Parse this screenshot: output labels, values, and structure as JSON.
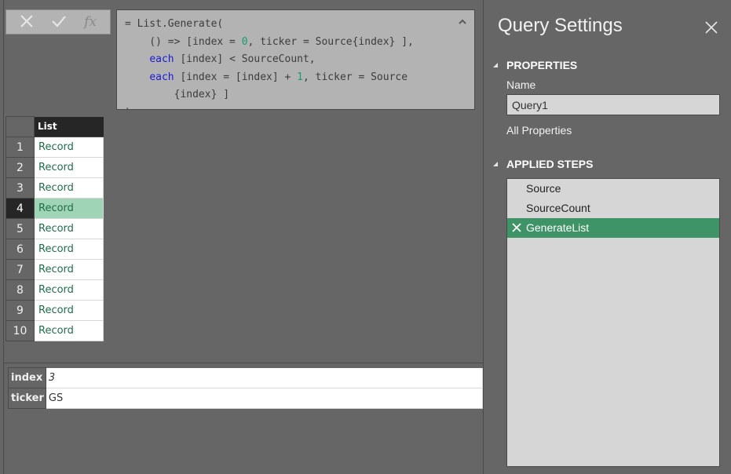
{
  "formula_bar": {
    "cancel_icon": "close-x-icon",
    "confirm_icon": "checkmark-icon",
    "fx_label": "fx",
    "lines": [
      {
        "parts": [
          {
            "t": "= List.Generate(",
            "c": ""
          }
        ]
      },
      {
        "parts": [
          {
            "t": "    () => [index = ",
            "c": ""
          },
          {
            "t": "0",
            "c": "num"
          },
          {
            "t": ", ticker = Source{index} ],",
            "c": ""
          }
        ]
      },
      {
        "parts": [
          {
            "t": "    ",
            "c": ""
          },
          {
            "t": "each",
            "c": "kw"
          },
          {
            "t": " [index] < SourceCount,",
            "c": ""
          }
        ]
      },
      {
        "parts": [
          {
            "t": "    ",
            "c": ""
          },
          {
            "t": "each",
            "c": "kw"
          },
          {
            "t": " [index = [index] + ",
            "c": ""
          },
          {
            "t": "1",
            "c": "num"
          },
          {
            "t": ", ticker = Source",
            "c": ""
          }
        ]
      },
      {
        "parts": [
          {
            "t": "        {index} ]",
            "c": ""
          }
        ]
      },
      {
        "parts": [
          {
            "t": ")",
            "c": ""
          }
        ]
      }
    ],
    "collapse_icon": "chevron-up-icon"
  },
  "grid": {
    "column_header": "List",
    "selected_row": 4,
    "rows": [
      {
        "num": "1",
        "value": "Record"
      },
      {
        "num": "2",
        "value": "Record"
      },
      {
        "num": "3",
        "value": "Record"
      },
      {
        "num": "4",
        "value": "Record"
      },
      {
        "num": "5",
        "value": "Record"
      },
      {
        "num": "6",
        "value": "Record"
      },
      {
        "num": "7",
        "value": "Record"
      },
      {
        "num": "8",
        "value": "Record"
      },
      {
        "num": "9",
        "value": "Record"
      },
      {
        "num": "10",
        "value": "Record"
      }
    ]
  },
  "record_preview": {
    "fields": [
      {
        "label": "index",
        "value": "3",
        "italic": true
      },
      {
        "label": "ticker",
        "value": "GS",
        "italic": false
      }
    ]
  },
  "query_settings": {
    "title": "Query Settings",
    "close_icon": "close-icon",
    "properties": {
      "heading": "PROPERTIES",
      "name_label": "Name",
      "name_value": "Query1",
      "all_properties_link": "All Properties"
    },
    "applied_steps": {
      "heading": "APPLIED STEPS",
      "steps": [
        {
          "label": "Source",
          "active": false
        },
        {
          "label": "SourceCount",
          "active": false
        },
        {
          "label": "GenerateList",
          "active": true
        }
      ]
    }
  },
  "colors": {
    "accent_green": "#3f9467",
    "selected_cell": "#9fd4b6",
    "record_text": "#1e6e4a",
    "keyword_blue": "#1b1bd6",
    "number_teal": "#1b9b6a"
  }
}
